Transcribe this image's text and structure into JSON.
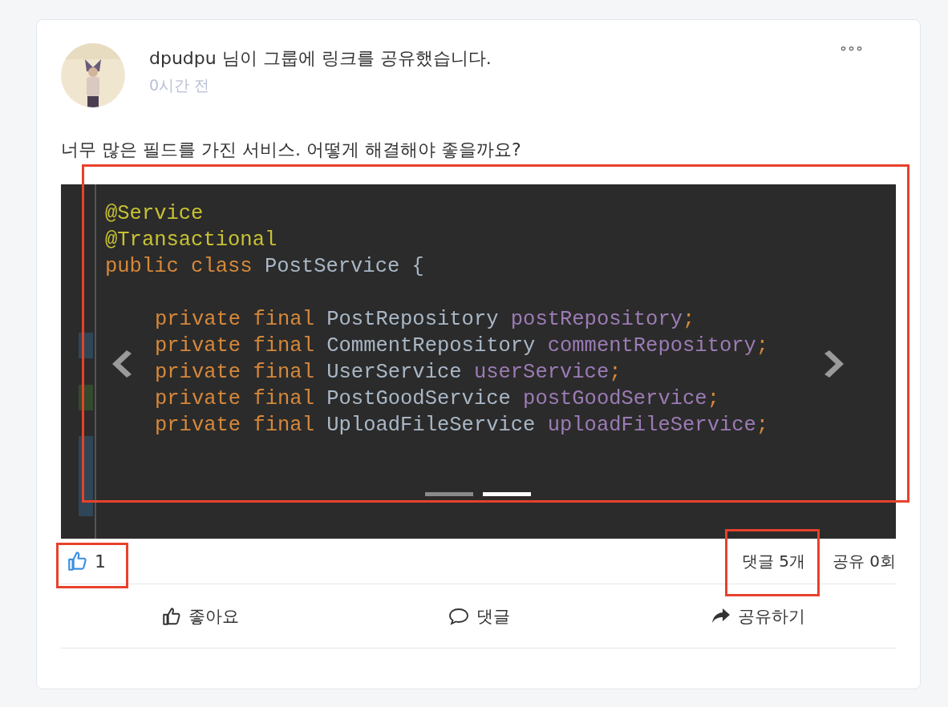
{
  "post": {
    "author_line": "dpudpu 님이 그룹에 링크를 공유했습니다.",
    "time": "0시간 전",
    "more": "°°°",
    "text": "너무 많은 필드를 가진 서비스. 어떻게 해결해야 좋을까요?",
    "image": {
      "highlighted": true,
      "code_lines": [
        {
          "kind": "top",
          "tokens": [
            {
              "kind": "annotation",
              "text": "@Service"
            }
          ]
        },
        {
          "kind": "top",
          "tokens": [
            {
              "kind": "annotation",
              "text": "@Transactional"
            }
          ]
        },
        {
          "kind": "top",
          "tokens": [
            {
              "kind": "keyword",
              "text": "public class "
            },
            {
              "kind": "type",
              "text": "PostService {"
            }
          ]
        },
        {
          "kind": "blank"
        },
        {
          "kind": "member",
          "tokens": [
            {
              "kind": "keyword",
              "text": "private final "
            },
            {
              "kind": "type",
              "text": "PostRepository "
            },
            {
              "kind": "field",
              "text": "postRepository"
            },
            {
              "kind": "keyword",
              "text": ";"
            }
          ]
        },
        {
          "kind": "member",
          "tokens": [
            {
              "kind": "keyword",
              "text": "private final "
            },
            {
              "kind": "type",
              "text": "CommentRepository "
            },
            {
              "kind": "field",
              "text": "commentRepository"
            },
            {
              "kind": "keyword",
              "text": ";"
            }
          ]
        },
        {
          "kind": "member",
          "tokens": [
            {
              "kind": "keyword",
              "text": "private final "
            },
            {
              "kind": "type",
              "text": "UserService "
            },
            {
              "kind": "field",
              "text": "userService"
            },
            {
              "kind": "keyword",
              "text": ";"
            }
          ]
        },
        {
          "kind": "member",
          "tokens": [
            {
              "kind": "keyword",
              "text": "private final "
            },
            {
              "kind": "type",
              "text": "PostGoodService "
            },
            {
              "kind": "field",
              "text": "postGoodService"
            },
            {
              "kind": "keyword",
              "text": ";"
            }
          ]
        },
        {
          "kind": "member",
          "tokens": [
            {
              "kind": "keyword",
              "text": "private final "
            },
            {
              "kind": "type",
              "text": "UploadFileService "
            },
            {
              "kind": "field",
              "text": "uploadFileService"
            },
            {
              "kind": "keyword",
              "text": ";"
            }
          ]
        }
      ],
      "dots": [
        {
          "selected": false
        },
        {
          "selected": true
        }
      ]
    },
    "likes": {
      "count": "1",
      "highlighted": true
    },
    "comment_count": {
      "text": "댓글 5개",
      "highlighted": true
    },
    "share_count": "공유 0회",
    "actions": [
      {
        "kind": "like",
        "label": "좋아요"
      },
      {
        "kind": "comment",
        "label": "댓글"
      },
      {
        "kind": "share",
        "label": "공유하기"
      }
    ]
  }
}
